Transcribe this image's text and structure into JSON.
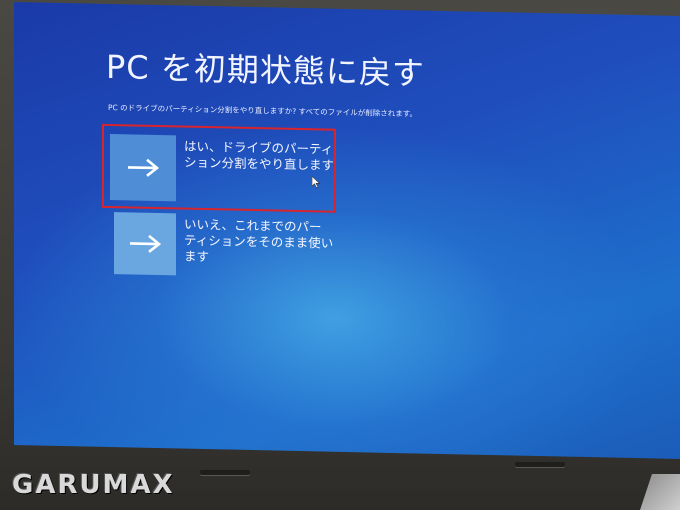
{
  "dialog": {
    "title": "PC を初期状態に戻す",
    "subtitle": "PC のドライブのパーティション分割をやり直しますか? すべてのファイルが削除されます。",
    "options": [
      {
        "label": "はい、ドライブのパーティション分割をやり直します",
        "icon": "arrow-right-icon"
      },
      {
        "label": "いいえ、これまでのパーティションをそのまま使います",
        "icon": "arrow-right-icon"
      }
    ]
  },
  "watermark": {
    "text": "GARUMAX"
  },
  "colors": {
    "screen_bg": "#1f4fbd",
    "tile_1": "#4f8ed6",
    "tile_2": "#6aa7e0",
    "highlight": "#d8242c",
    "text": "#f2f5ff"
  }
}
